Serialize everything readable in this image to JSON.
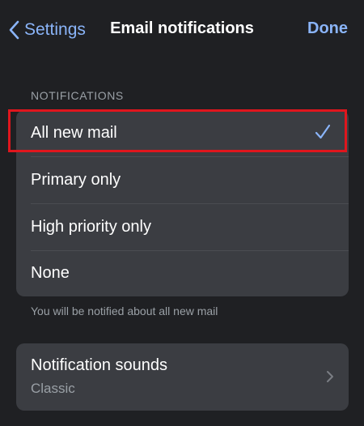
{
  "nav": {
    "back_label": "Settings",
    "title": "Email notifications",
    "done_label": "Done"
  },
  "notifications": {
    "header": "NOTIFICATIONS",
    "options": [
      {
        "label": "All new mail",
        "selected": true
      },
      {
        "label": "Primary only",
        "selected": false
      },
      {
        "label": "High priority only",
        "selected": false
      },
      {
        "label": "None",
        "selected": false
      }
    ],
    "footnote": "You will be notified about all new mail"
  },
  "sounds": {
    "title": "Notification sounds",
    "value": "Classic"
  },
  "colors": {
    "accent": "#8ab4f8",
    "highlight_box": "#e0161d",
    "background": "#1f2023",
    "group_background": "#3b3d42"
  }
}
